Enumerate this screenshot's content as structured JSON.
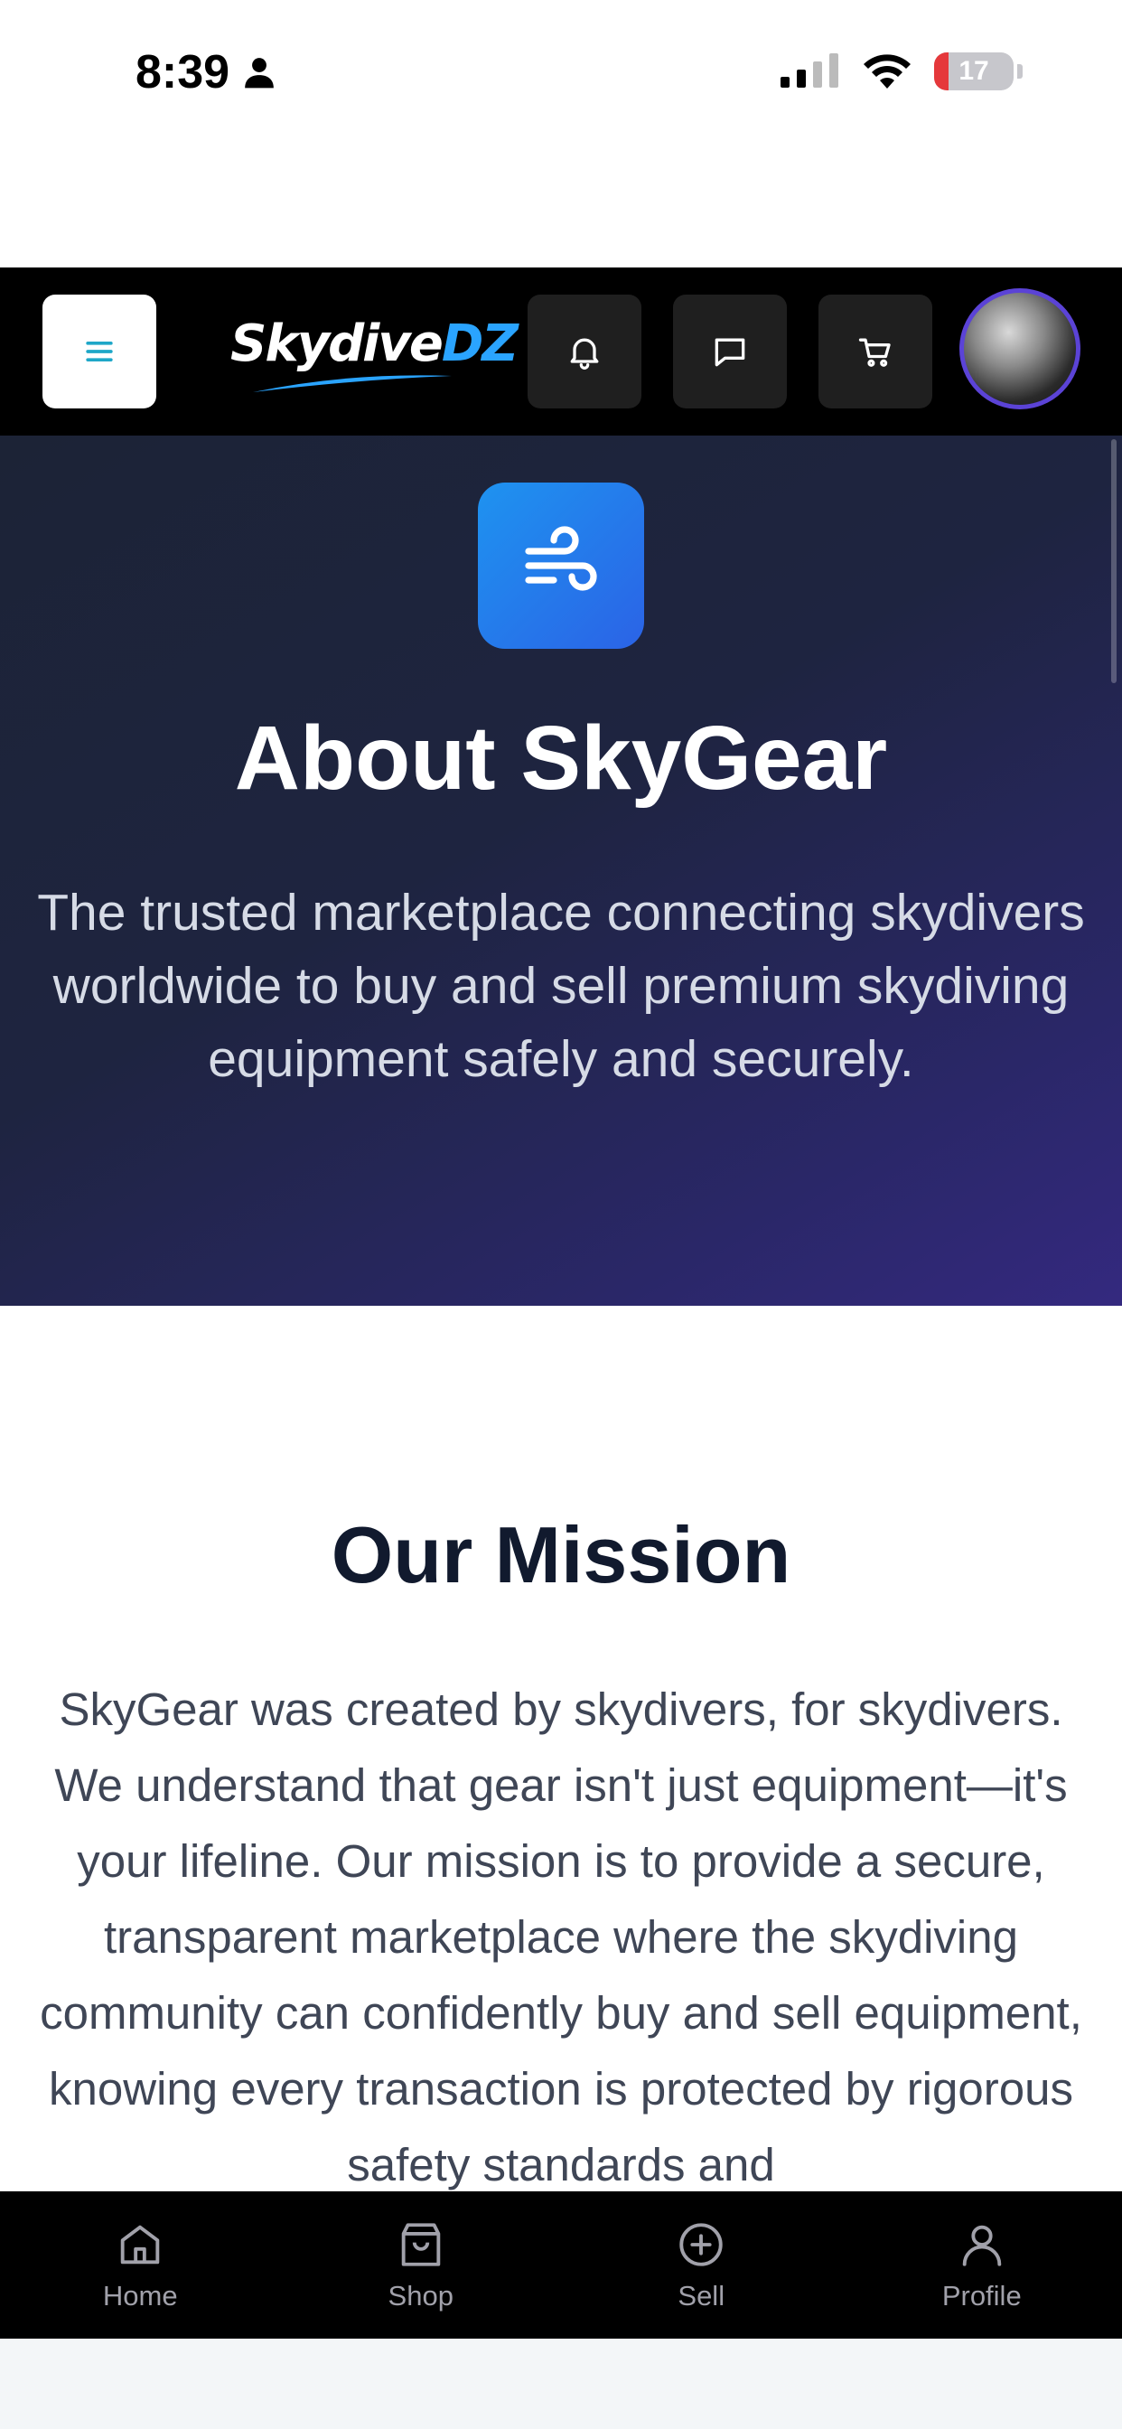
{
  "status_bar": {
    "time": "8:39",
    "battery_level": "17"
  },
  "header": {
    "logo_part1": "Skydive",
    "logo_part2": "DZ"
  },
  "hero": {
    "title": "About SkyGear",
    "description": "The trusted marketplace connecting skydivers worldwide to buy and sell premium skydiving equipment safely and securely."
  },
  "mission": {
    "title": "Our Mission",
    "text": "SkyGear was created by skydivers, for skydivers. We understand that gear isn't just equipment—it's your lifeline. Our mission is to provide a secure, transparent marketplace where the skydiving community can confidently buy and sell equipment, knowing every transaction is protected by rigorous safety standards and"
  },
  "tabs": [
    {
      "label": "Home",
      "icon": "home-icon"
    },
    {
      "label": "Shop",
      "icon": "shopping-bag-icon"
    },
    {
      "label": "Sell",
      "icon": "plus-circle-icon"
    },
    {
      "label": "Profile",
      "icon": "user-icon"
    }
  ],
  "colors": {
    "accent": "#2b63e6",
    "hero_start": "#1c2336",
    "hero_end": "#34297f",
    "avatar_ring": "#5b43d6",
    "menu_icon": "#1ea7c8"
  }
}
